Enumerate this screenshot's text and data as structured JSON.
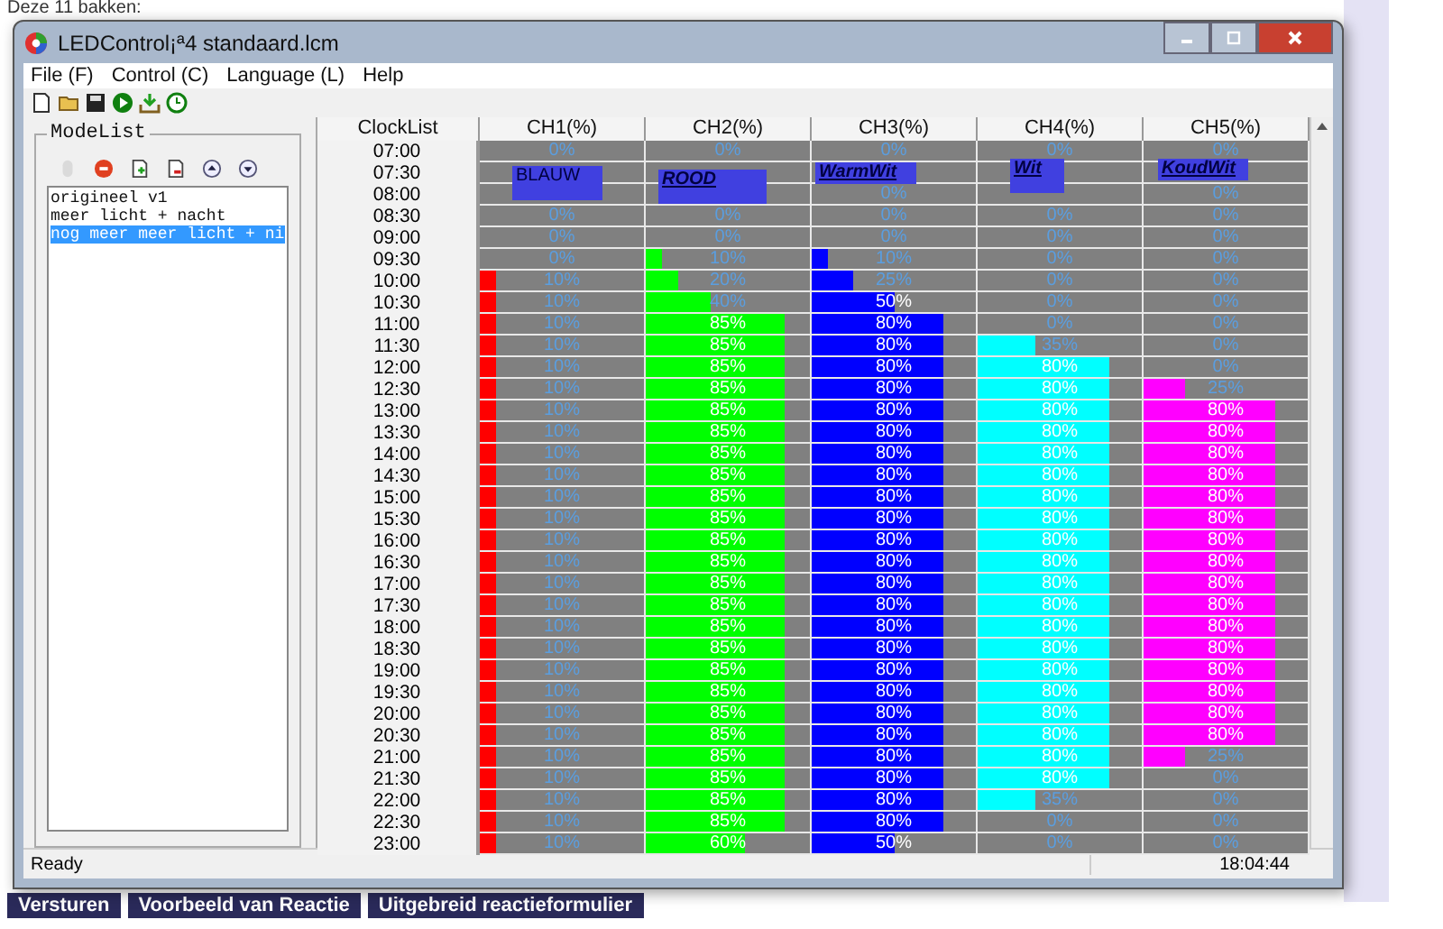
{
  "background_page": {
    "heading": "Deze 11 bakken:",
    "buttons": [
      "Versturen",
      "Voorbeeld van Reactie",
      "Uitgebreid reactieformulier"
    ]
  },
  "window": {
    "title": "LEDControl¡ª4 standaard.lcm"
  },
  "menu": [
    "File (F)",
    "Control (C)",
    "Language (L)",
    "Help"
  ],
  "mode_list": {
    "title": "ModeList",
    "tools": [
      {
        "disabled": true
      },
      {
        "disabled": false
      },
      {
        "disabled": false
      },
      {
        "disabled": false
      },
      {
        "disabled": false
      },
      {
        "disabled": false
      }
    ],
    "items": [
      {
        "label": "origineel v1",
        "selected": false
      },
      {
        "label": "meer licht + nacht",
        "selected": false
      },
      {
        "label": "nog meer meer licht + ni",
        "selected": true
      }
    ]
  },
  "schedule": {
    "time_header": "ClockList",
    "channels": [
      {
        "header": "CH1(%)",
        "label": "BLAUW",
        "color": "#ff0000"
      },
      {
        "header": "CH2(%)",
        "label": "ROOD",
        "color": "#00ff00"
      },
      {
        "header": "CH3(%)",
        "label": "WarmWit",
        "color": "#0000ff"
      },
      {
        "header": "CH4(%)",
        "label": "Wit",
        "color": "#00ffff"
      },
      {
        "header": "CH5(%)",
        "label": "KoudWit",
        "color": "#ff00ff"
      }
    ],
    "rows": [
      {
        "time": "07:00",
        "cells": [
          {
            "text": "0%"
          },
          {
            "text": "0%"
          },
          {
            "text": "0%"
          },
          {
            "text": "0%"
          },
          {
            "text": "0%"
          }
        ]
      },
      {
        "time": "07:30",
        "cells": [
          {},
          {},
          {},
          {},
          {}
        ]
      },
      {
        "time": "08:00",
        "cells": [
          {},
          {},
          {
            "text": "0%"
          },
          {},
          {
            "text": "0%"
          }
        ]
      },
      {
        "time": "08:30",
        "cells": [
          {
            "text": "0%"
          },
          {
            "text": "0%"
          },
          {
            "text": "0%"
          },
          {
            "text": "0%"
          },
          {
            "text": "0%"
          }
        ]
      },
      {
        "time": "09:00",
        "cells": [
          {
            "text": "0%"
          },
          {
            "text": "0%"
          },
          {
            "text": "0%"
          },
          {
            "text": "0%"
          },
          {
            "text": "0%"
          }
        ]
      },
      {
        "time": "09:30",
        "cells": [
          {
            "text": "0%"
          },
          {
            "level": 0.1,
            "text": "10%"
          },
          {
            "level": 0.1,
            "text": "10%"
          },
          {
            "text": "0%"
          },
          {
            "text": "0%"
          }
        ]
      },
      {
        "time": "10:00",
        "cells": [
          {
            "level": 0.1,
            "text": "10%"
          },
          {
            "level": 0.2,
            "text": "20%"
          },
          {
            "level": 0.25,
            "text": "25%"
          },
          {
            "text": "0%"
          },
          {
            "text": "0%"
          }
        ]
      },
      {
        "time": "10:30",
        "cells": [
          {
            "level": 0.1,
            "text": "10%"
          },
          {
            "level": 0.4,
            "text": "40%"
          },
          {
            "level": 0.5,
            "text": "50%"
          },
          {
            "text": "0%"
          },
          {
            "text": "0%"
          }
        ]
      },
      {
        "time": "11:00",
        "cells": [
          {
            "level": 0.1,
            "text": "10%"
          },
          {
            "level": 0.85,
            "text": "85%"
          },
          {
            "level": 0.8,
            "text": "80%"
          },
          {
            "text": "0%"
          },
          {
            "text": "0%"
          }
        ]
      },
      {
        "time": "11:30",
        "cells": [
          {
            "level": 0.1,
            "text": "10%"
          },
          {
            "level": 0.85,
            "text": "85%"
          },
          {
            "level": 0.8,
            "text": "80%"
          },
          {
            "level": 0.35,
            "text": "35%"
          },
          {
            "text": "0%"
          }
        ]
      },
      {
        "time": "12:00",
        "cells": [
          {
            "level": 0.1,
            "text": "10%"
          },
          {
            "level": 0.85,
            "text": "85%"
          },
          {
            "level": 0.8,
            "text": "80%"
          },
          {
            "level": 0.8,
            "text": "80%"
          },
          {
            "text": "0%"
          }
        ]
      },
      {
        "time": "12:30",
        "cells": [
          {
            "level": 0.1,
            "text": "10%"
          },
          {
            "level": 0.85,
            "text": "85%"
          },
          {
            "level": 0.8,
            "text": "80%"
          },
          {
            "level": 0.8,
            "text": "80%"
          },
          {
            "level": 0.25,
            "text": "25%"
          }
        ]
      },
      {
        "time": "13:00",
        "cells": [
          {
            "level": 0.1,
            "text": "10%"
          },
          {
            "level": 0.85,
            "text": "85%"
          },
          {
            "level": 0.8,
            "text": "80%"
          },
          {
            "level": 0.8,
            "text": "80%"
          },
          {
            "level": 0.8,
            "text": "80%"
          }
        ]
      },
      {
        "time": "13:30",
        "cells": [
          {
            "level": 0.1,
            "text": "10%"
          },
          {
            "level": 0.85,
            "text": "85%"
          },
          {
            "level": 0.8,
            "text": "80%"
          },
          {
            "level": 0.8,
            "text": "80%"
          },
          {
            "level": 0.8,
            "text": "80%"
          }
        ]
      },
      {
        "time": "14:00",
        "cells": [
          {
            "level": 0.1,
            "text": "10%"
          },
          {
            "level": 0.85,
            "text": "85%"
          },
          {
            "level": 0.8,
            "text": "80%"
          },
          {
            "level": 0.8,
            "text": "80%"
          },
          {
            "level": 0.8,
            "text": "80%"
          }
        ]
      },
      {
        "time": "14:30",
        "cells": [
          {
            "level": 0.1,
            "text": "10%"
          },
          {
            "level": 0.85,
            "text": "85%"
          },
          {
            "level": 0.8,
            "text": "80%"
          },
          {
            "level": 0.8,
            "text": "80%"
          },
          {
            "level": 0.8,
            "text": "80%"
          }
        ]
      },
      {
        "time": "15:00",
        "cells": [
          {
            "level": 0.1,
            "text": "10%"
          },
          {
            "level": 0.85,
            "text": "85%"
          },
          {
            "level": 0.8,
            "text": "80%"
          },
          {
            "level": 0.8,
            "text": "80%"
          },
          {
            "level": 0.8,
            "text": "80%"
          }
        ]
      },
      {
        "time": "15:30",
        "cells": [
          {
            "level": 0.1,
            "text": "10%"
          },
          {
            "level": 0.85,
            "text": "85%"
          },
          {
            "level": 0.8,
            "text": "80%"
          },
          {
            "level": 0.8,
            "text": "80%"
          },
          {
            "level": 0.8,
            "text": "80%"
          }
        ]
      },
      {
        "time": "16:00",
        "cells": [
          {
            "level": 0.1,
            "text": "10%"
          },
          {
            "level": 0.85,
            "text": "85%"
          },
          {
            "level": 0.8,
            "text": "80%"
          },
          {
            "level": 0.8,
            "text": "80%"
          },
          {
            "level": 0.8,
            "text": "80%"
          }
        ]
      },
      {
        "time": "16:30",
        "cells": [
          {
            "level": 0.1,
            "text": "10%"
          },
          {
            "level": 0.85,
            "text": "85%"
          },
          {
            "level": 0.8,
            "text": "80%"
          },
          {
            "level": 0.8,
            "text": "80%"
          },
          {
            "level": 0.8,
            "text": "80%"
          }
        ]
      },
      {
        "time": "17:00",
        "cells": [
          {
            "level": 0.1,
            "text": "10%"
          },
          {
            "level": 0.85,
            "text": "85%"
          },
          {
            "level": 0.8,
            "text": "80%"
          },
          {
            "level": 0.8,
            "text": "80%"
          },
          {
            "level": 0.8,
            "text": "80%"
          }
        ]
      },
      {
        "time": "17:30",
        "cells": [
          {
            "level": 0.1,
            "text": "10%"
          },
          {
            "level": 0.85,
            "text": "85%"
          },
          {
            "level": 0.8,
            "text": "80%"
          },
          {
            "level": 0.8,
            "text": "80%"
          },
          {
            "level": 0.8,
            "text": "80%"
          }
        ]
      },
      {
        "time": "18:00",
        "cells": [
          {
            "level": 0.1,
            "text": "10%"
          },
          {
            "level": 0.85,
            "text": "85%"
          },
          {
            "level": 0.8,
            "text": "80%"
          },
          {
            "level": 0.8,
            "text": "80%"
          },
          {
            "level": 0.8,
            "text": "80%"
          }
        ]
      },
      {
        "time": "18:30",
        "cells": [
          {
            "level": 0.1,
            "text": "10%"
          },
          {
            "level": 0.85,
            "text": "85%"
          },
          {
            "level": 0.8,
            "text": "80%"
          },
          {
            "level": 0.8,
            "text": "80%"
          },
          {
            "level": 0.8,
            "text": "80%"
          }
        ]
      },
      {
        "time": "19:00",
        "cells": [
          {
            "level": 0.1,
            "text": "10%"
          },
          {
            "level": 0.85,
            "text": "85%"
          },
          {
            "level": 0.8,
            "text": "80%"
          },
          {
            "level": 0.8,
            "text": "80%"
          },
          {
            "level": 0.8,
            "text": "80%"
          }
        ]
      },
      {
        "time": "19:30",
        "cells": [
          {
            "level": 0.1,
            "text": "10%"
          },
          {
            "level": 0.85,
            "text": "85%"
          },
          {
            "level": 0.8,
            "text": "80%"
          },
          {
            "level": 0.8,
            "text": "80%"
          },
          {
            "level": 0.8,
            "text": "80%"
          }
        ]
      },
      {
        "time": "20:00",
        "cells": [
          {
            "level": 0.1,
            "text": "10%"
          },
          {
            "level": 0.85,
            "text": "85%"
          },
          {
            "level": 0.8,
            "text": "80%"
          },
          {
            "level": 0.8,
            "text": "80%"
          },
          {
            "level": 0.8,
            "text": "80%"
          }
        ]
      },
      {
        "time": "20:30",
        "cells": [
          {
            "level": 0.1,
            "text": "10%"
          },
          {
            "level": 0.85,
            "text": "85%"
          },
          {
            "level": 0.8,
            "text": "80%"
          },
          {
            "level": 0.8,
            "text": "80%"
          },
          {
            "level": 0.8,
            "text": "80%"
          }
        ]
      },
      {
        "time": "21:00",
        "cells": [
          {
            "level": 0.1,
            "text": "10%"
          },
          {
            "level": 0.85,
            "text": "85%"
          },
          {
            "level": 0.8,
            "text": "80%"
          },
          {
            "level": 0.8,
            "text": "80%"
          },
          {
            "level": 0.25,
            "text": "25%"
          }
        ]
      },
      {
        "time": "21:30",
        "cells": [
          {
            "level": 0.1,
            "text": "10%"
          },
          {
            "level": 0.85,
            "text": "85%"
          },
          {
            "level": 0.8,
            "text": "80%"
          },
          {
            "level": 0.8,
            "text": "80%"
          },
          {
            "text": "0%"
          }
        ]
      },
      {
        "time": "22:00",
        "cells": [
          {
            "level": 0.1,
            "text": "10%"
          },
          {
            "level": 0.85,
            "text": "85%"
          },
          {
            "level": 0.8,
            "text": "80%"
          },
          {
            "level": 0.35,
            "text": "35%"
          },
          {
            "text": "0%"
          }
        ]
      },
      {
        "time": "22:30",
        "cells": [
          {
            "level": 0.1,
            "text": "10%"
          },
          {
            "level": 0.85,
            "text": "85%"
          },
          {
            "level": 0.8,
            "text": "80%"
          },
          {
            "text": "0%"
          },
          {
            "text": "0%"
          }
        ]
      },
      {
        "time": "23:00",
        "cells": [
          {
            "level": 0.1,
            "text": "10%"
          },
          {
            "level": 0.6,
            "text": "60%"
          },
          {
            "level": 0.5,
            "text": "50%"
          },
          {
            "text": "0%"
          },
          {
            "text": "0%"
          }
        ]
      }
    ]
  },
  "status_bar": {
    "message": "Ready",
    "time": "18:04:44"
  }
}
